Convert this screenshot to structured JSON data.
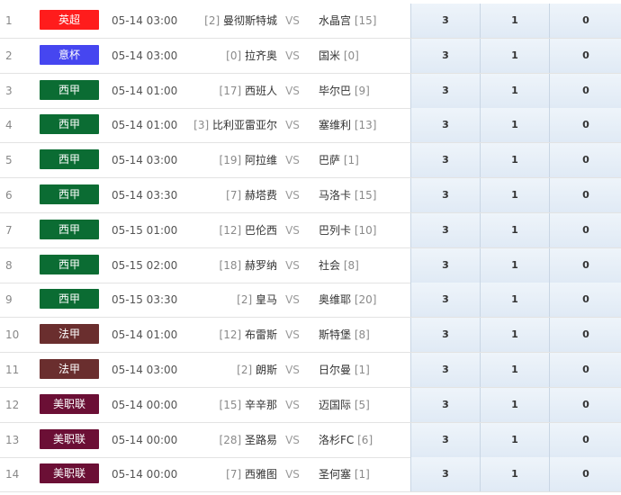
{
  "matches": [
    {
      "num": "1",
      "league": "英超",
      "color": "#ff1c1c",
      "time": "05-14 03:00",
      "home_rank": "[2]",
      "home": "曼彻斯特城",
      "vs": "VS",
      "away": "水晶宫",
      "away_rank": "[15]",
      "odds": [
        "3",
        "1",
        "0"
      ]
    },
    {
      "num": "2",
      "league": "意杯",
      "color": "#4646f0",
      "time": "05-14 03:00",
      "home_rank": "[0]",
      "home": "拉齐奥",
      "vs": "VS",
      "away": "国米",
      "away_rank": "[0]",
      "odds": [
        "3",
        "1",
        "0"
      ]
    },
    {
      "num": "3",
      "league": "西甲",
      "color": "#0b6c33",
      "time": "05-14 01:00",
      "home_rank": "[17]",
      "home": "西班人",
      "vs": "VS",
      "away": "毕尔巴",
      "away_rank": "[9]",
      "odds": [
        "3",
        "1",
        "0"
      ]
    },
    {
      "num": "4",
      "league": "西甲",
      "color": "#0b6c33",
      "time": "05-14 01:00",
      "home_rank": "[3]",
      "home": "比利亚雷亚尔",
      "vs": "VS",
      "away": "塞维利",
      "away_rank": "[13]",
      "odds": [
        "3",
        "1",
        "0"
      ]
    },
    {
      "num": "5",
      "league": "西甲",
      "color": "#0b6c33",
      "time": "05-14 03:00",
      "home_rank": "[19]",
      "home": "阿拉维",
      "vs": "VS",
      "away": "巴萨",
      "away_rank": "[1]",
      "odds": [
        "3",
        "1",
        "0"
      ]
    },
    {
      "num": "6",
      "league": "西甲",
      "color": "#0b6c33",
      "time": "05-14 03:30",
      "home_rank": "[7]",
      "home": "赫塔费",
      "vs": "VS",
      "away": "马洛卡",
      "away_rank": "[15]",
      "odds": [
        "3",
        "1",
        "0"
      ]
    },
    {
      "num": "7",
      "league": "西甲",
      "color": "#0b6c33",
      "time": "05-15 01:00",
      "home_rank": "[12]",
      "home": "巴伦西",
      "vs": "VS",
      "away": "巴列卡",
      "away_rank": "[10]",
      "odds": [
        "3",
        "1",
        "0"
      ]
    },
    {
      "num": "8",
      "league": "西甲",
      "color": "#0b6c33",
      "time": "05-15 02:00",
      "home_rank": "[18]",
      "home": "赫罗纳",
      "vs": "VS",
      "away": "社会",
      "away_rank": "[8]",
      "odds": [
        "3",
        "1",
        "0"
      ]
    },
    {
      "num": "9",
      "league": "西甲",
      "color": "#0b6c33",
      "time": "05-15 03:30",
      "home_rank": "[2]",
      "home": "皇马",
      "vs": "VS",
      "away": "奥维耶",
      "away_rank": "[20]",
      "odds": [
        "3",
        "1",
        "0"
      ]
    },
    {
      "num": "10",
      "league": "法甲",
      "color": "#6a2e2e",
      "time": "05-14 01:00",
      "home_rank": "[12]",
      "home": "布雷斯",
      "vs": "VS",
      "away": "斯特堡",
      "away_rank": "[8]",
      "odds": [
        "3",
        "1",
        "0"
      ]
    },
    {
      "num": "11",
      "league": "法甲",
      "color": "#6a2e2e",
      "time": "05-14 03:00",
      "home_rank": "[2]",
      "home": "朗斯",
      "vs": "VS",
      "away": "日尔曼",
      "away_rank": "[1]",
      "odds": [
        "3",
        "1",
        "0"
      ]
    },
    {
      "num": "12",
      "league": "美职联",
      "color": "#6b0f35",
      "time": "05-14 00:00",
      "home_rank": "[15]",
      "home": "辛辛那",
      "vs": "VS",
      "away": "迈国际",
      "away_rank": "[5]",
      "odds": [
        "3",
        "1",
        "0"
      ]
    },
    {
      "num": "13",
      "league": "美职联",
      "color": "#6b0f35",
      "time": "05-14 00:00",
      "home_rank": "[28]",
      "home": "圣路易",
      "vs": "VS",
      "away": "洛杉FC",
      "away_rank": "[6]",
      "odds": [
        "3",
        "1",
        "0"
      ]
    },
    {
      "num": "14",
      "league": "美职联",
      "color": "#6b0f35",
      "time": "05-14 00:00",
      "home_rank": "[7]",
      "home": "西雅图",
      "vs": "VS",
      "away": "圣何塞",
      "away_rank": "[1]",
      "odds": [
        "3",
        "1",
        "0"
      ]
    }
  ]
}
